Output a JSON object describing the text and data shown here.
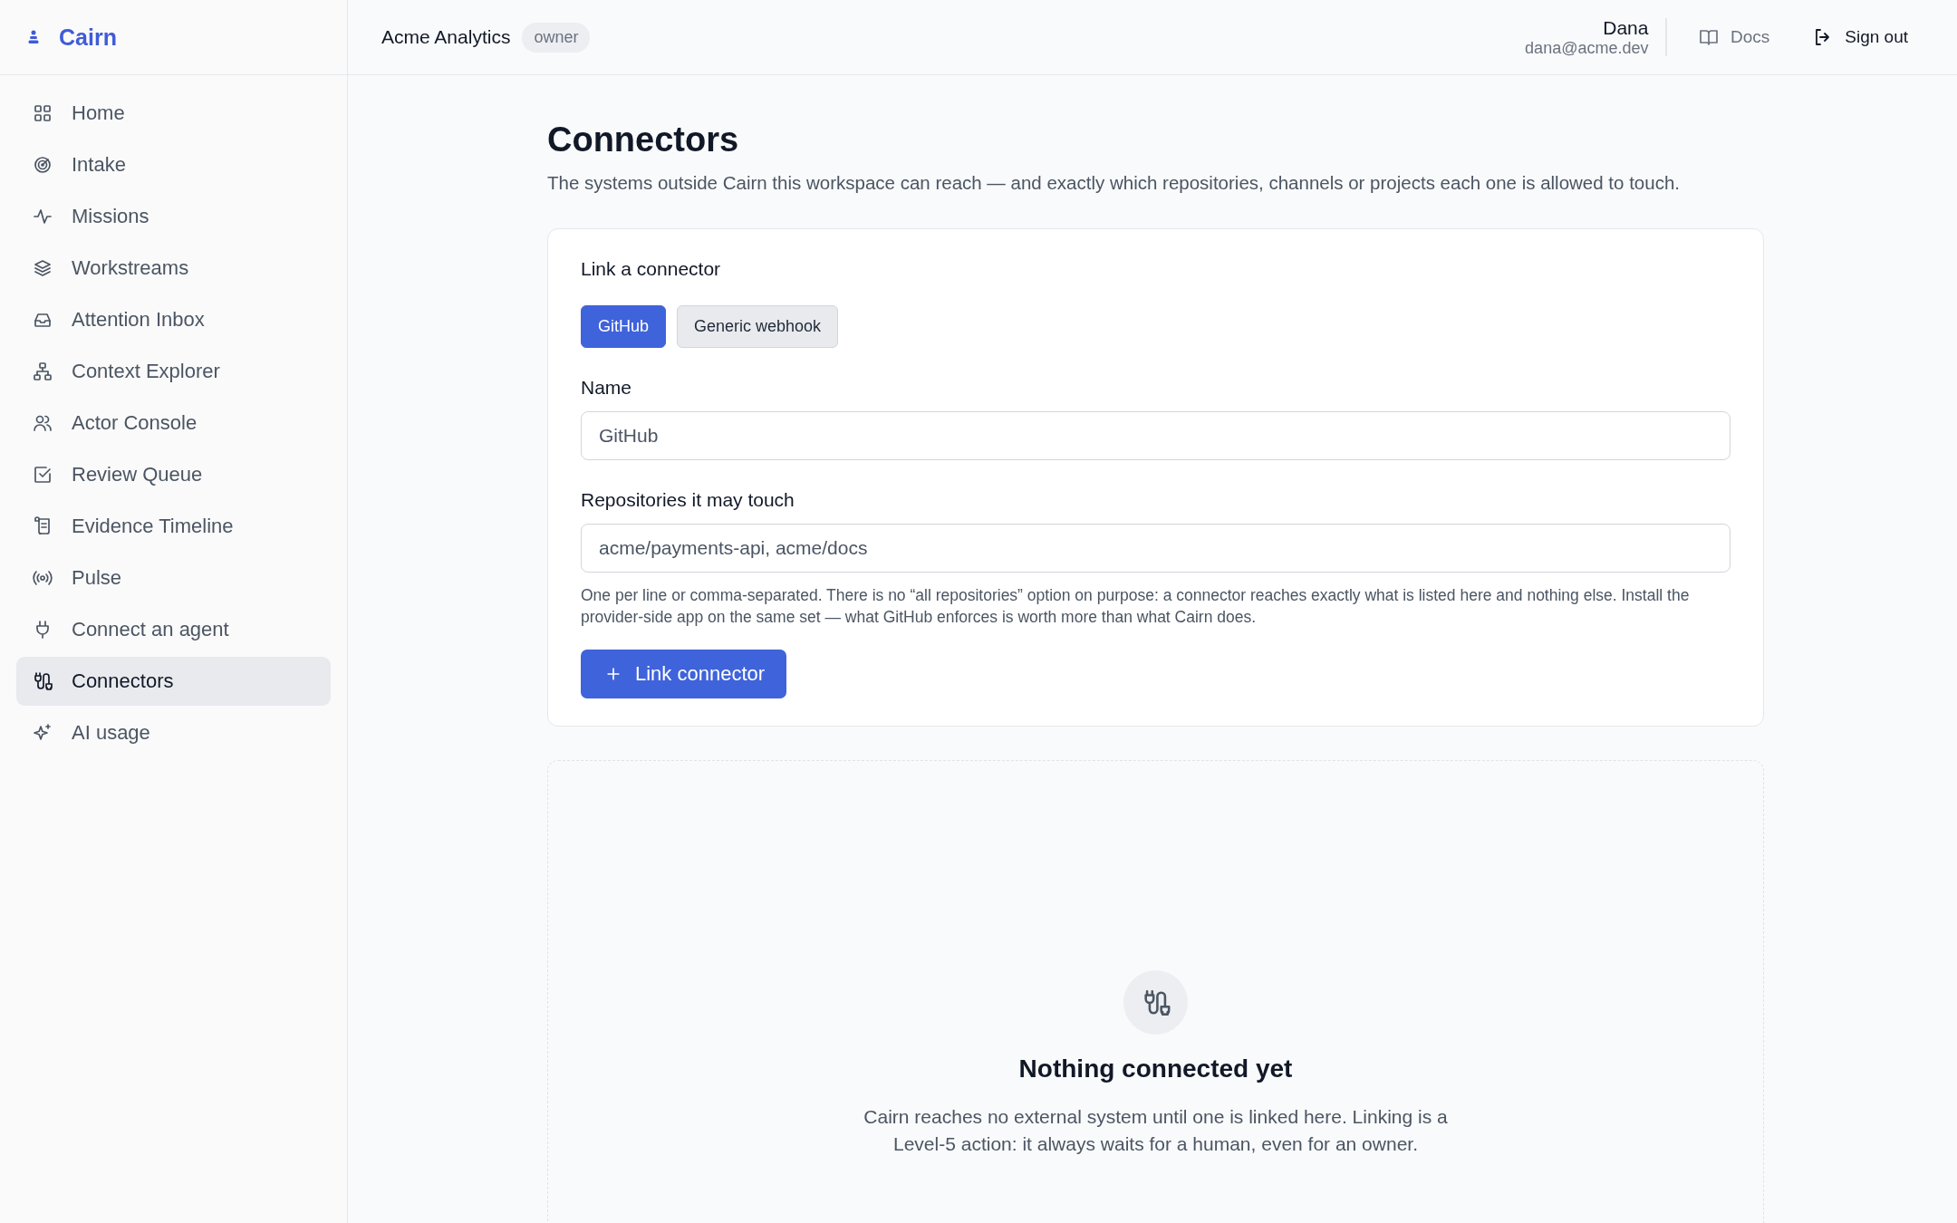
{
  "brand": {
    "name": "Cairn"
  },
  "header": {
    "workspace": "Acme Analytics",
    "role": "owner",
    "user_name": "Dana",
    "user_email": "dana@acme.dev",
    "docs": "Docs",
    "sign_out": "Sign out"
  },
  "sidebar": {
    "items": [
      {
        "label": "Home",
        "selected": false
      },
      {
        "label": "Intake",
        "selected": false
      },
      {
        "label": "Missions",
        "selected": false
      },
      {
        "label": "Workstreams",
        "selected": false
      },
      {
        "label": "Attention Inbox",
        "selected": false
      },
      {
        "label": "Context Explorer",
        "selected": false
      },
      {
        "label": "Actor Console",
        "selected": false
      },
      {
        "label": "Review Queue",
        "selected": false
      },
      {
        "label": "Evidence Timeline",
        "selected": false
      },
      {
        "label": "Pulse",
        "selected": false
      },
      {
        "label": "Connect an agent",
        "selected": false
      },
      {
        "label": "Connectors",
        "selected": true
      },
      {
        "label": "AI usage",
        "selected": false
      }
    ]
  },
  "page": {
    "title": "Connectors",
    "subtitle": "The systems outside Cairn this workspace can reach — and exactly which repositories, channels or projects each one is allowed to touch."
  },
  "form": {
    "heading": "Link a connector",
    "types": [
      {
        "label": "GitHub",
        "selected": true
      },
      {
        "label": "Generic webhook",
        "selected": false
      }
    ],
    "name_label": "Name",
    "name_value": "GitHub",
    "repos_label": "Repositories it may touch",
    "repos_value": "acme/payments-api, acme/docs",
    "help": "One per line or comma-separated. There is no “all repositories” option on purpose: a connector reaches exactly what is listed here and nothing else. Install the provider-side app on the same set — what GitHub enforces is worth more than what Cairn does.",
    "submit": "Link connector"
  },
  "empty": {
    "title": "Nothing connected yet",
    "text": "Cairn reaches no external system until one is linked here. Linking is a Level-5 action: it always waits for a human, even for an owner."
  }
}
